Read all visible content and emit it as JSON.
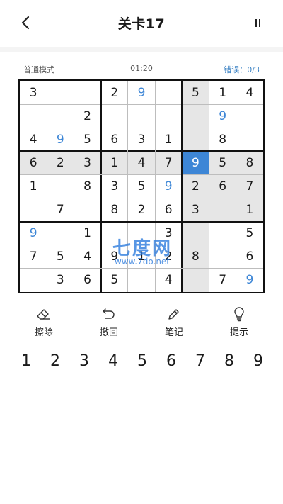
{
  "header": {
    "title": "关卡17"
  },
  "status": {
    "mode": "普通模式",
    "timer": "01:20",
    "errors": "错误：0/3"
  },
  "board": {
    "rows": [
      [
        "3",
        "",
        "",
        "2",
        "9",
        "",
        "5",
        "1",
        "4"
      ],
      [
        "",
        "",
        "2",
        "",
        "",
        "",
        "",
        "9",
        ""
      ],
      [
        "4",
        "9",
        "5",
        "6",
        "3",
        "1",
        "",
        "8",
        ""
      ],
      [
        "6",
        "2",
        "3",
        "1",
        "4",
        "7",
        "9",
        "5",
        "8"
      ],
      [
        "1",
        "",
        "8",
        "3",
        "5",
        "9",
        "2",
        "6",
        "7"
      ],
      [
        "",
        "7",
        "",
        "8",
        "2",
        "6",
        "3",
        "",
        "1"
      ],
      [
        "9",
        "",
        "1",
        "",
        "",
        "3",
        "",
        "",
        "5"
      ],
      [
        "7",
        "5",
        "4",
        "9",
        "1",
        "2",
        "8",
        "",
        "6"
      ],
      [
        "",
        "3",
        "6",
        "5",
        "",
        "4",
        "",
        "7",
        "9"
      ]
    ],
    "blue_cells": [
      [
        0,
        4
      ],
      [
        1,
        7
      ],
      [
        2,
        1
      ],
      [
        3,
        6
      ],
      [
        4,
        5
      ],
      [
        6,
        0
      ],
      [
        8,
        8
      ]
    ],
    "selected": [
      3,
      6
    ],
    "shaded_row": 3,
    "shaded_col": 6,
    "extra_shaded": [
      [
        4,
        6
      ],
      [
        4,
        7
      ],
      [
        4,
        8
      ],
      [
        5,
        6
      ],
      [
        5,
        7
      ],
      [
        5,
        8
      ]
    ],
    "colors": {
      "selected": "#3d86d6",
      "shade": "#e6e6e6",
      "blue": "#3d86d6"
    }
  },
  "watermark": {
    "main": "七度网",
    "sub": "www.7do.net"
  },
  "tools": [
    {
      "label": "擦除",
      "icon": "eraser-icon"
    },
    {
      "label": "撤回",
      "icon": "undo-icon"
    },
    {
      "label": "笔记",
      "icon": "pencil-icon"
    },
    {
      "label": "提示",
      "icon": "lightbulb-icon"
    }
  ],
  "numpad": [
    "1",
    "2",
    "3",
    "4",
    "5",
    "6",
    "7",
    "8",
    "9"
  ]
}
